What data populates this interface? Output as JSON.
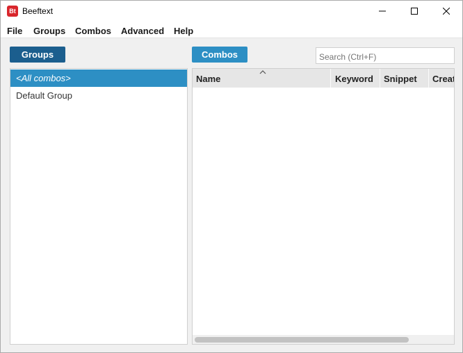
{
  "window": {
    "title": "Beeftext",
    "icon_text": "Bt",
    "icon_color": "#d9262c"
  },
  "menu": {
    "items": [
      "File",
      "Groups",
      "Combos",
      "Advanced",
      "Help"
    ]
  },
  "groups_panel": {
    "header": "Groups",
    "items": [
      "<All combos>",
      "Default Group"
    ],
    "selected_index": 0
  },
  "combos_panel": {
    "header": "Combos",
    "search_placeholder": "Search (Ctrl+F)",
    "columns": [
      "Name",
      "Keyword",
      "Snippet",
      "Creat"
    ],
    "rows": []
  },
  "colors": {
    "groups_header": "#1b5e8e",
    "combos_header": "#2d8fc4",
    "selection": "#2d8fc4"
  }
}
